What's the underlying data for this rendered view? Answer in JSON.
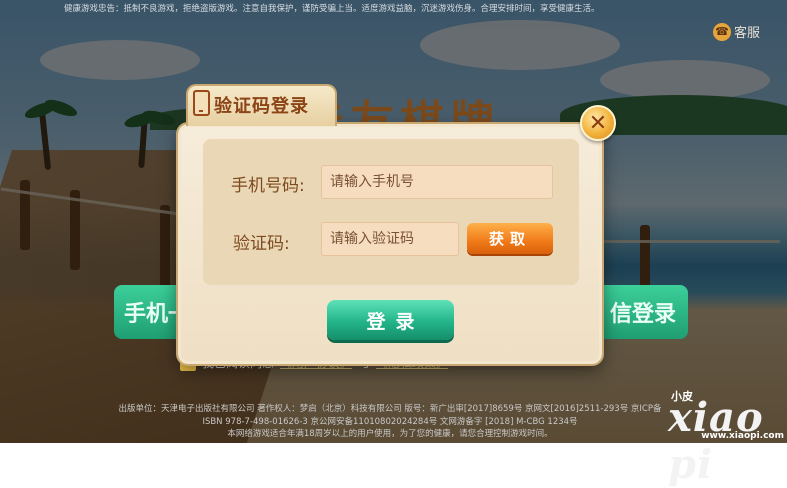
{
  "notice": "健康游戏忠告：抵制不良游戏，拒绝盗版游戏。注意自我保护，谨防受骗上当。适度游戏益脑，沉迷游戏伤身。合理安排时间，享受健康生活。",
  "service_label": "客服",
  "bg_title": "亲友棋牌",
  "side_buttons": {
    "left": "手机一",
    "right": "信登录"
  },
  "agree": {
    "prefix": "我已阅读同意",
    "link1": "《用户协议》",
    "mid": "与",
    "link2": "《隐私政策》",
    "checked_mark": "✓"
  },
  "footer": [
    "出版单位：天津电子出版社有限公司 著作权人：梦启（北京）科技有限公司 版号：新广出审[2017]8659号 京网文[2016]2511-293号 京ICP备",
    "ISBN 978-7-498-01626-3 京公网安备11010802024284号 文网游备字 [2018] M-CBG 1234号",
    "本网络游戏适合年满18周岁以上的用户使用，为了您的健康，请您合理控制游戏时间。"
  ],
  "dialog": {
    "title": "验证码登录",
    "close_symbol": "✕",
    "phone_label": "手机号码:",
    "phone_placeholder": "请输入手机号",
    "code_label": "验证码:",
    "code_placeholder": "请输入验证码",
    "get_code_label": "获取",
    "login_label": "登录"
  },
  "watermark": {
    "small": "小皮",
    "big": "xiao pi",
    "url": "www.xiaopi.com"
  },
  "colors": {
    "accent_orange": "#f07a18",
    "login_green": "#23b489",
    "dialog_bg": "#f6ecda"
  }
}
